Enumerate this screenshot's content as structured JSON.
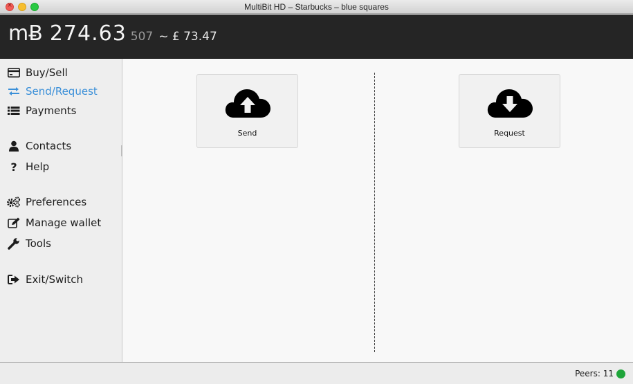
{
  "window": {
    "title": "MultiBit HD – Starbucks – blue squares"
  },
  "header": {
    "symbol": "mɃ",
    "balance_main": "274.63",
    "balance_sub": "507",
    "fiat": "~ £ 73.47"
  },
  "sidebar": {
    "items": [
      {
        "label": "Buy/Sell",
        "icon": "credit-card-icon",
        "active": false
      },
      {
        "label": "Send/Request",
        "icon": "exchange-arrows-icon",
        "active": true
      },
      {
        "label": "Payments",
        "icon": "list-icon",
        "active": false
      },
      {
        "label": "Contacts",
        "icon": "user-icon",
        "active": false
      },
      {
        "label": "Help",
        "icon": "question-icon",
        "active": false
      },
      {
        "label": "Preferences",
        "icon": "gears-icon",
        "active": false
      },
      {
        "label": "Manage wallet",
        "icon": "edit-icon",
        "active": false
      },
      {
        "label": "Tools",
        "icon": "wrench-icon",
        "active": false
      },
      {
        "label": "Exit/Switch",
        "icon": "sign-out-icon",
        "active": false
      }
    ]
  },
  "main": {
    "send_label": "Send",
    "request_label": "Request"
  },
  "status": {
    "peers": "Peers: 11"
  },
  "colors": {
    "header_bg": "#252525",
    "active_nav": "#3a8fd8",
    "peer_ok": "#1fa53a"
  }
}
